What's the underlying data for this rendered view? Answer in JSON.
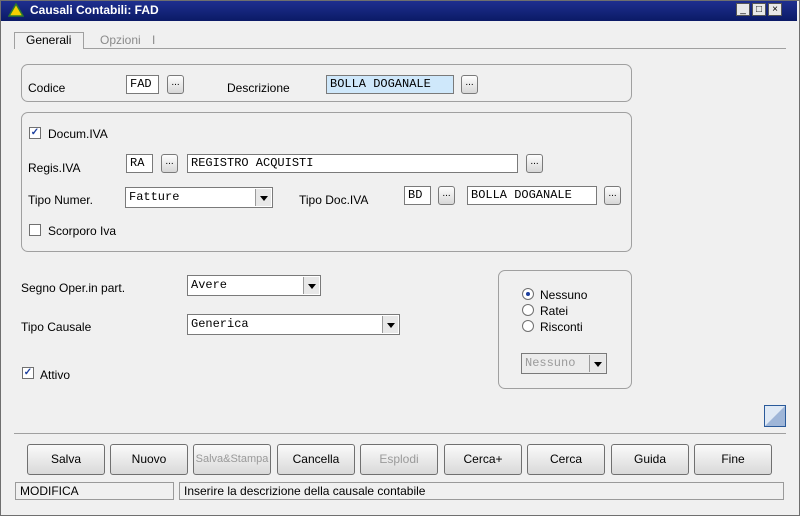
{
  "window": {
    "title": "Causali Contabili: FAD",
    "min": "_",
    "max": "□",
    "close": "×"
  },
  "tabs": [
    {
      "label": "Generali"
    },
    {
      "label": "Opzioni"
    }
  ],
  "codice": {
    "label": "Codice",
    "value": "FAD",
    "btn": "..."
  },
  "descrizione": {
    "label": "Descrizione",
    "value": "BOLLA DOGANALE",
    "btn": "..."
  },
  "docum_iva": {
    "label": "Docum.IVA",
    "checked": true
  },
  "regis_iva": {
    "label": "Regis.IVA",
    "code": "RA",
    "btn": "...",
    "desc": "REGISTRO ACQUISTI",
    "desc_btn": "..."
  },
  "tipo_numer": {
    "label": "Tipo Numer.",
    "value": "Fatture"
  },
  "tipo_doc_iva": {
    "label": "Tipo Doc.IVA",
    "code": "BD",
    "btn": "...",
    "desc": "BOLLA DOGANALE",
    "desc_btn": "..."
  },
  "scorporo": {
    "label": "Scorporo Iva",
    "checked": false
  },
  "segno": {
    "label": "Segno Oper.in part.",
    "value": "Avere"
  },
  "tipo_causale": {
    "label": "Tipo Causale",
    "value": "Generica"
  },
  "attivo": {
    "label": "Attivo",
    "checked": true
  },
  "radios": [
    {
      "label": "Nessuno",
      "selected": true
    },
    {
      "label": "Ratei",
      "selected": false
    },
    {
      "label": "Risconti",
      "selected": false
    }
  ],
  "radio_select": {
    "value": "Nessuno"
  },
  "buttons": [
    {
      "label": "Salva",
      "enabled": true
    },
    {
      "label": "Nuovo",
      "enabled": true
    },
    {
      "label": "Salva&Stampa",
      "enabled": false
    },
    {
      "label": "Cancella",
      "enabled": true
    },
    {
      "label": "Esplodi",
      "enabled": false
    },
    {
      "label": "Cerca+",
      "enabled": true
    },
    {
      "label": "Cerca",
      "enabled": true
    },
    {
      "label": "Guida",
      "enabled": true
    },
    {
      "label": "Fine",
      "enabled": true
    }
  ],
  "status": {
    "mode": "MODIFICA",
    "message": "Inserire la descrizione della causale contabile"
  },
  "colors": {
    "titlebar": "#0b1a66",
    "highlight_field": "#cfe8fb",
    "check": "#1c3f9e"
  }
}
